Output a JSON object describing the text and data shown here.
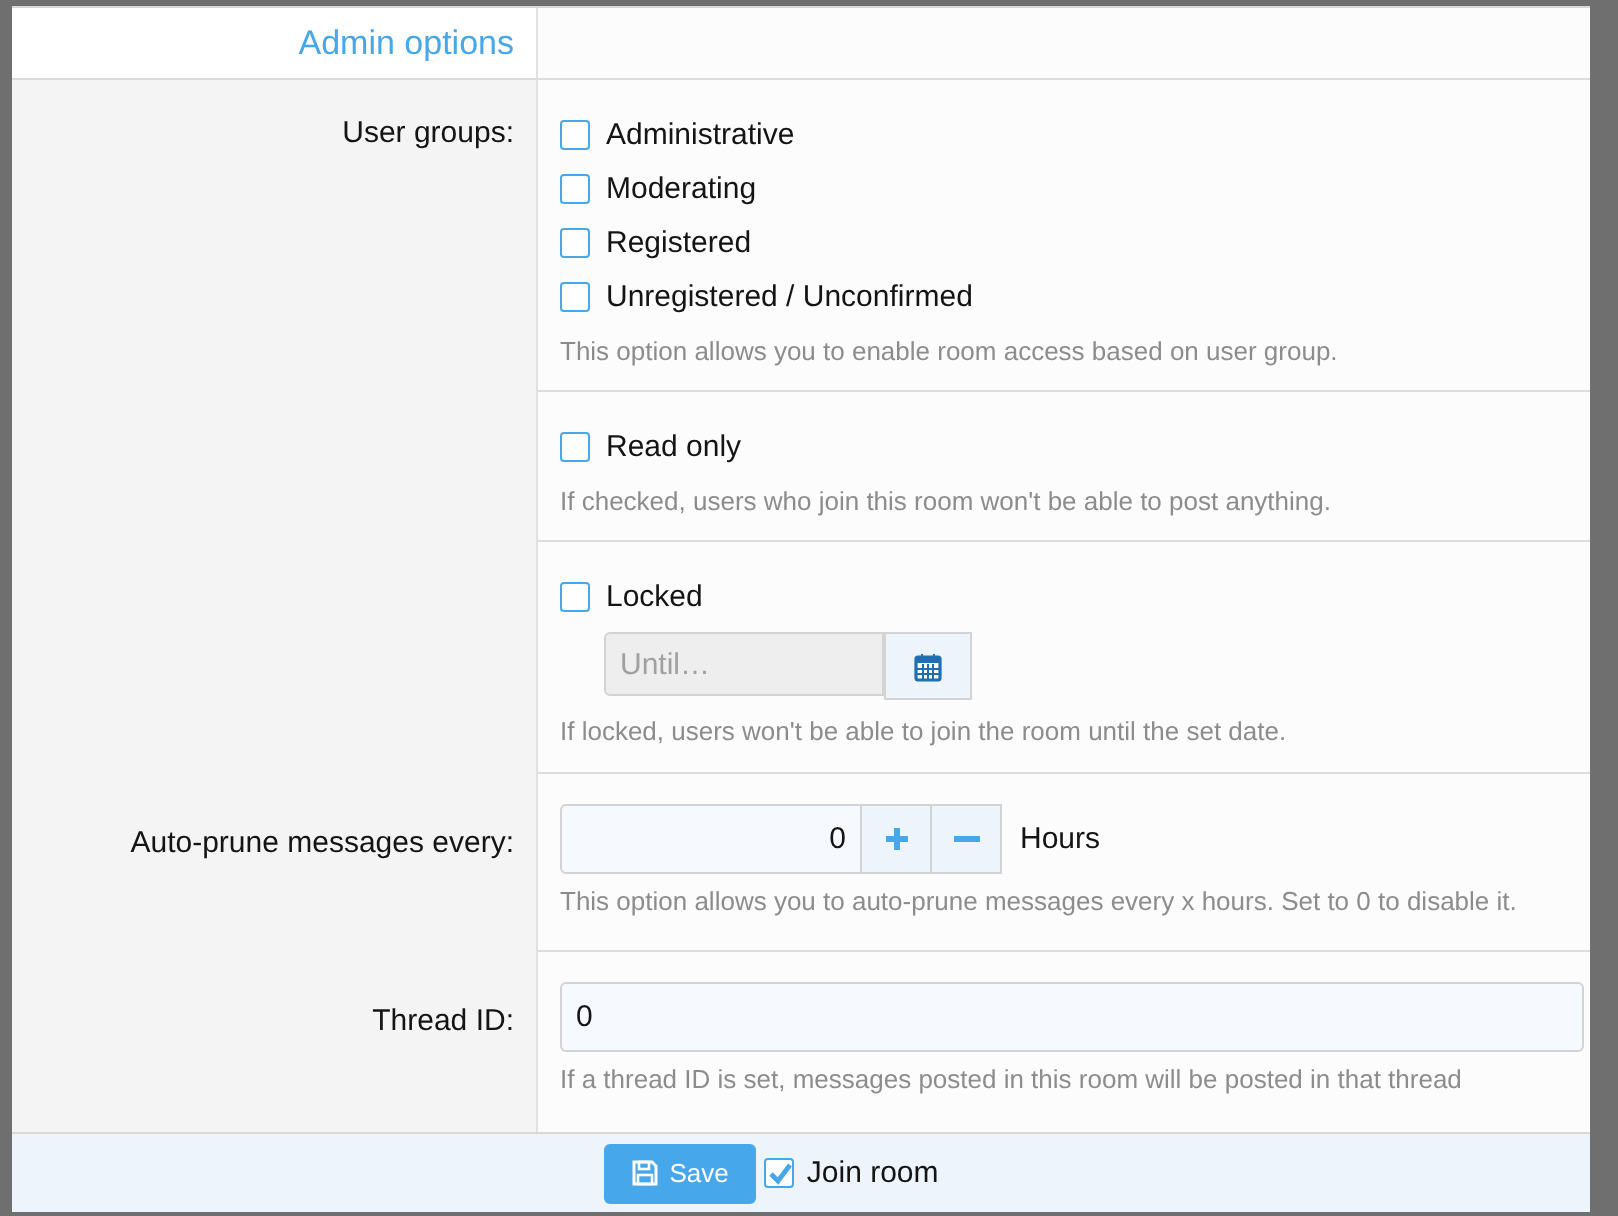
{
  "section_title": "Admin options",
  "rows": [
    {
      "kind": "checkboxes",
      "label": "User groups:",
      "options": [
        {
          "label": "Administrative",
          "checked": false
        },
        {
          "label": "Moderating",
          "checked": false
        },
        {
          "label": "Registered",
          "checked": false
        },
        {
          "label": "Unregistered / Unconfirmed",
          "checked": false
        }
      ],
      "hint": "This option allows you to enable room access based on user group."
    },
    {
      "kind": "checkboxes",
      "options": [
        {
          "label": "Read only",
          "checked": false
        }
      ],
      "hint": "If checked, users who join this room won't be able to post anything."
    },
    {
      "kind": "lock",
      "options": [
        {
          "label": "Locked",
          "checked": false
        }
      ],
      "date_placeholder": "Until…",
      "hint": "If locked, users won't be able to join the room until the set date."
    },
    {
      "kind": "spinner",
      "label": "Auto-prune messages every:",
      "value": "0",
      "unit": "Hours",
      "hint": "This option allows you to auto-prune messages every x hours. Set to 0 to disable it."
    },
    {
      "kind": "text",
      "label": "Thread ID:",
      "value": "0",
      "hint": "If a thread ID is set, messages posted in this room will be posted in that thread"
    }
  ],
  "footer": {
    "save_label": "Save",
    "join": {
      "label": "Join room",
      "checked": true
    }
  }
}
